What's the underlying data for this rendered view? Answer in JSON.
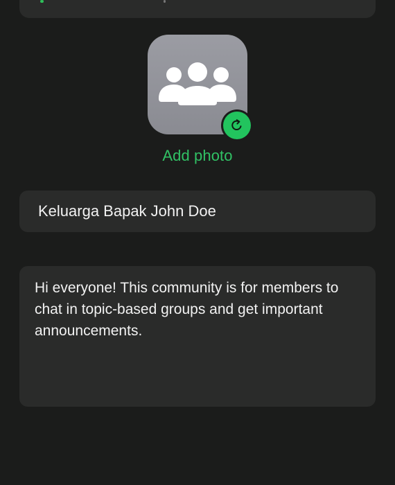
{
  "header_card": {},
  "avatar": {
    "icon": "group-people-icon",
    "badge_icon": "refresh-icon",
    "action_label": "Add photo"
  },
  "community": {
    "name": "Keluarga Bapak John Doe",
    "description": "Hi everyone! This community is for members to chat in topic-based groups and get important announcements."
  },
  "colors": {
    "background": "#1b1c1b",
    "card": "#2a2b2a",
    "accent": "#31c265",
    "avatar_bg": "#9b9ca3"
  }
}
